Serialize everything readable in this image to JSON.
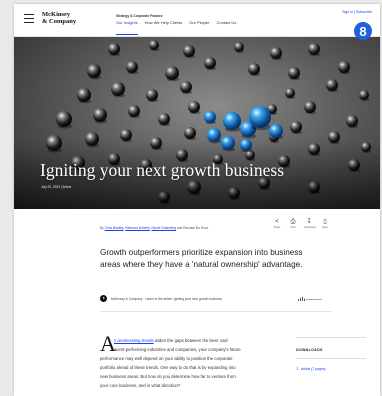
{
  "header": {
    "logo_line1": "McKinsey",
    "logo_line2": "& Company",
    "nav_kicker": "Strategy & Corporate Finance",
    "nav": [
      "Our Insights",
      "How We Help Clients",
      "Our People",
      "Contact Us"
    ],
    "signin": "Sign in | Subscribe"
  },
  "badge": {
    "label": "8",
    "color": "#1f5fe0"
  },
  "hero": {
    "title": "Igniting your next growth business",
    "meta": "July 20, 2023 | Article"
  },
  "article": {
    "byline_prefix": "By",
    "authors": [
      "Chris Bradley",
      "Rebecca Doherty",
      "Nicole Grassberg"
    ],
    "byline_suffix": "and Rachael Mc Rock",
    "share": [
      {
        "label": "Share",
        "icon": "share-icon"
      },
      {
        "label": "Print",
        "icon": "print-icon"
      },
      {
        "label": "Download",
        "icon": "download-icon"
      },
      {
        "label": "Save",
        "icon": "bookmark-icon"
      }
    ],
    "lede": "Growth outperformers prioritize expansion into business areas where they have a 'natural ownership' advantage.",
    "audio_text": "McKinsey & Company - Listen to the article: Igniting your next growth business",
    "dropcap": "A",
    "body": [
      {
        "link": "s accelerating trends",
        "rest": " widen the gaps between the best- and"
      },
      {
        "text": "worst-performing industries and companies, your company's future"
      },
      {
        "text": "performance may well depend on your ability to position the corporate"
      },
      {
        "text": "portfolio ahead of these trends. One way to do that is by expanding into"
      },
      {
        "text": "new business areas. But how do you determine how far to venture from"
      },
      {
        "text": "your core business, and in what direction?"
      }
    ]
  },
  "downloads": {
    "title": "DOWNLOADS",
    "link": "Article (7 pages)"
  },
  "colors": {
    "accent": "#1f40e6",
    "sphere_highlight": "#2b9ae8"
  }
}
